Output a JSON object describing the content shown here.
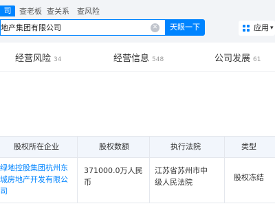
{
  "header": {
    "tabs": [
      {
        "label": "司",
        "active": true
      },
      {
        "label": "查老板"
      },
      {
        "label": "查关系"
      },
      {
        "label": "查风险"
      }
    ],
    "search": {
      "value": "地产集团有限公司"
    },
    "search_button": "天眼一下",
    "apps_button": "应用"
  },
  "categories": [
    {
      "label": "经营风险",
      "count": "34"
    },
    {
      "label": "经营信息",
      "count": "548"
    },
    {
      "label": "公司发展",
      "count": "61"
    }
  ],
  "table": {
    "headers": [
      "股权所在企业",
      "股权数额",
      "执行法院",
      "类型"
    ],
    "rows": [
      {
        "company_line1": "绿地控股集团杭州东",
        "company_line2": "城房地产开发有限公",
        "company_line3": "司",
        "amount_line1": "371000.0万人民",
        "amount_line2": "币",
        "court_line1": "江苏省苏州市中",
        "court_line2": "级人民法院",
        "type": "股权冻结"
      }
    ]
  },
  "colors": {
    "accent": "#0084ff",
    "header_bg": "#f2f4f7",
    "table_head_bg": "#f2f6fc"
  }
}
